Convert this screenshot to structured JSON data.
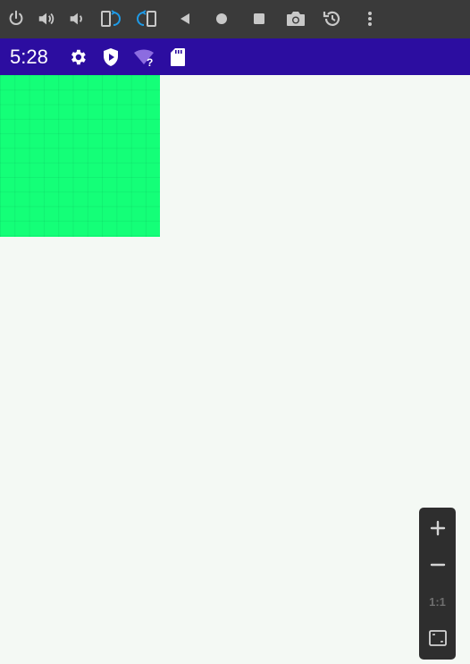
{
  "emulator_toolbar": {
    "buttons": [
      {
        "name": "power-icon"
      },
      {
        "name": "volume-up-icon"
      },
      {
        "name": "volume-down-icon"
      },
      {
        "name": "rotate-left-icon"
      },
      {
        "name": "rotate-right-icon"
      },
      {
        "name": "back-icon"
      },
      {
        "name": "home-icon"
      },
      {
        "name": "overview-icon"
      },
      {
        "name": "camera-icon"
      },
      {
        "name": "snapshot-icon"
      },
      {
        "name": "more-icon"
      }
    ],
    "accent_color": "#1e9be8"
  },
  "status_bar": {
    "time": "5:28",
    "background": "#2c0da0",
    "icons": [
      "settings-icon",
      "play-protect-icon",
      "wifi-unknown-icon",
      "sd-card-icon"
    ],
    "wifi_badge": "?"
  },
  "content": {
    "grid_color": "#14ff78"
  },
  "zoom_controls": {
    "zoom_in_icon": "plus-icon",
    "zoom_out_icon": "minus-icon",
    "actual_size_label": "1:1",
    "fit_icon": "fit-screen-icon"
  }
}
